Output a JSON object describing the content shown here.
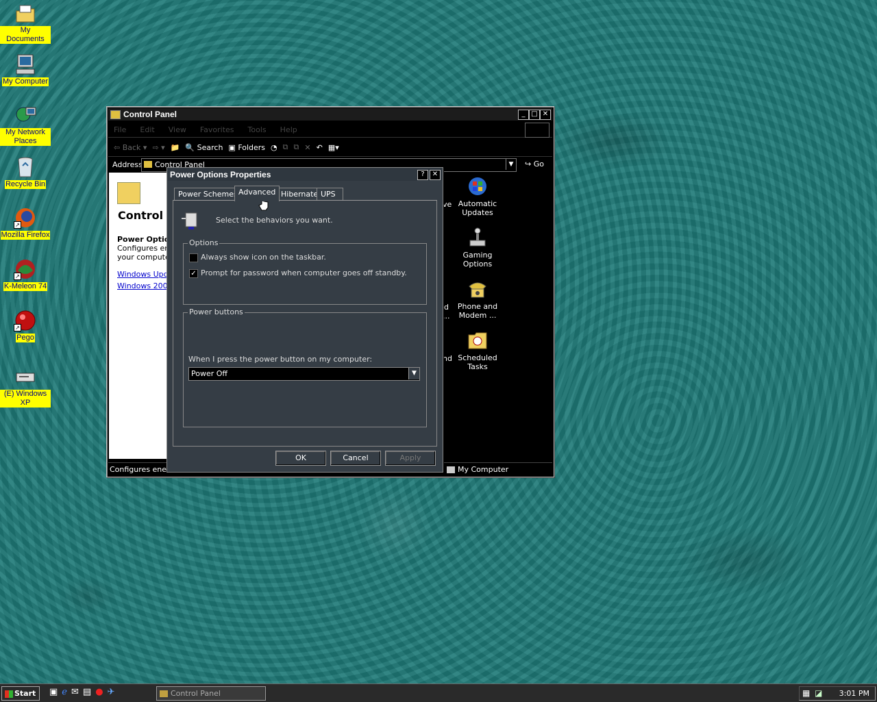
{
  "desktop": {
    "icons": [
      {
        "label": "My Documents",
        "icon": "folder-documents-icon"
      },
      {
        "label": "My Computer",
        "icon": "computer-icon"
      },
      {
        "label": "My Network Places",
        "icon": "network-icon"
      },
      {
        "label": "Recycle Bin",
        "icon": "recycle-bin-icon"
      },
      {
        "label": "Mozilla Firefox",
        "icon": "firefox-icon"
      },
      {
        "label": "K-Meleon 74",
        "icon": "kmeleon-icon"
      },
      {
        "label": "Pego",
        "icon": "pego-icon"
      },
      {
        "label": "(E) Windows XP",
        "icon": "cd-drive-icon"
      }
    ]
  },
  "window": {
    "title": "Control Panel",
    "menu": [
      "File",
      "Edit",
      "View",
      "Favorites",
      "Tools",
      "Help"
    ],
    "toolbar": {
      "back": "Back",
      "search": "Search",
      "folders": "Folders"
    },
    "address_label": "Address",
    "address_value": "Control Panel",
    "go_label": "Go",
    "left_pane": {
      "heading": "Control P",
      "section_title": "Power Option",
      "desc_line1": "Configures ene",
      "desc_line2": "your computer",
      "link1": "Windows Upda",
      "link2": "Windows 2000"
    },
    "items": [
      {
        "label": "Automatic Updates",
        "icon": "windows-update-icon"
      },
      {
        "label": "Gaming Options",
        "icon": "joystick-icon"
      },
      {
        "label": "Phone and Modem ...",
        "icon": "phone-icon"
      },
      {
        "label": "Scheduled Tasks",
        "icon": "scheduled-tasks-icon"
      }
    ],
    "partial_labels": [
      "ve",
      "d",
      "...",
      "nd"
    ],
    "status_left": "Configures energ",
    "status_right": "My Computer"
  },
  "dialog": {
    "title": "Power Options Properties",
    "tabs": [
      "Power Schemes",
      "Advanced",
      "Hibernate",
      "UPS"
    ],
    "active_tab": "Advanced",
    "intro": "Select the behaviors you want.",
    "options_group": "Options",
    "option1": {
      "label": "Always show icon on the taskbar.",
      "checked": false
    },
    "option2": {
      "label": "Prompt for password when computer goes off standby.",
      "checked": true
    },
    "power_group": "Power buttons",
    "power_prompt": "When I press the power button on my computer:",
    "power_value": "Power Off",
    "ok": "OK",
    "cancel": "Cancel",
    "apply": "Apply"
  },
  "taskbar": {
    "start": "Start",
    "task": "Control Panel",
    "clock": "3:01 PM"
  }
}
